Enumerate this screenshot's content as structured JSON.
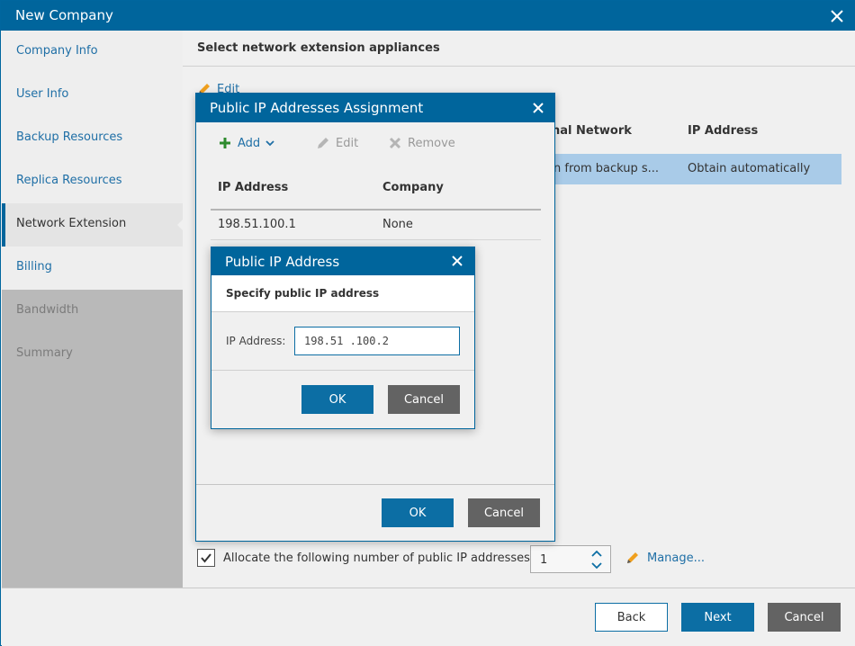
{
  "window": {
    "title": "New Company"
  },
  "sidebar": {
    "items": [
      {
        "label": "Company Info",
        "state": "link"
      },
      {
        "label": "User Info",
        "state": "link"
      },
      {
        "label": "Backup Resources",
        "state": "link"
      },
      {
        "label": "Replica Resources",
        "state": "link"
      },
      {
        "label": "Network Extension",
        "state": "active"
      },
      {
        "label": "Billing",
        "state": "link"
      },
      {
        "label": "Bandwidth",
        "state": "disabled"
      },
      {
        "label": "Summary",
        "state": "disabled"
      }
    ]
  },
  "main": {
    "heading": "Select network extension appliances",
    "edit_label": "Edit",
    "table_headers": {
      "network": "nal Network",
      "ip": "IP Address"
    },
    "row": {
      "network": "n from backup s...",
      "ip": "Obtain automatically"
    },
    "allocate": {
      "checked": true,
      "label": "Allocate the following number of public IP addresses",
      "count": "1"
    },
    "manage_label": "Manage..."
  },
  "footer": {
    "back": "Back",
    "next": "Next",
    "cancel": "Cancel"
  },
  "assignment_dialog": {
    "title": "Public IP Addresses Assignment",
    "toolbar": {
      "add": "Add",
      "edit": "Edit",
      "remove": "Remove"
    },
    "headers": {
      "ip": "IP Address",
      "company": "Company"
    },
    "rows": [
      {
        "ip": "198.51.100.1",
        "company": "None"
      }
    ],
    "ok": "OK",
    "cancel": "Cancel"
  },
  "ip_dialog": {
    "title": "Public IP Address",
    "heading": "Specify public IP address",
    "field_label": "IP Address:",
    "field_value": "198.51 .100.2",
    "ok": "OK",
    "cancel": "Cancel"
  },
  "colors": {
    "titlebar": "#00659c",
    "accent": "#0c6ea4",
    "link": "#1f6fa6",
    "selected_row": "#a9cbe8",
    "gray_button": "#636363"
  }
}
